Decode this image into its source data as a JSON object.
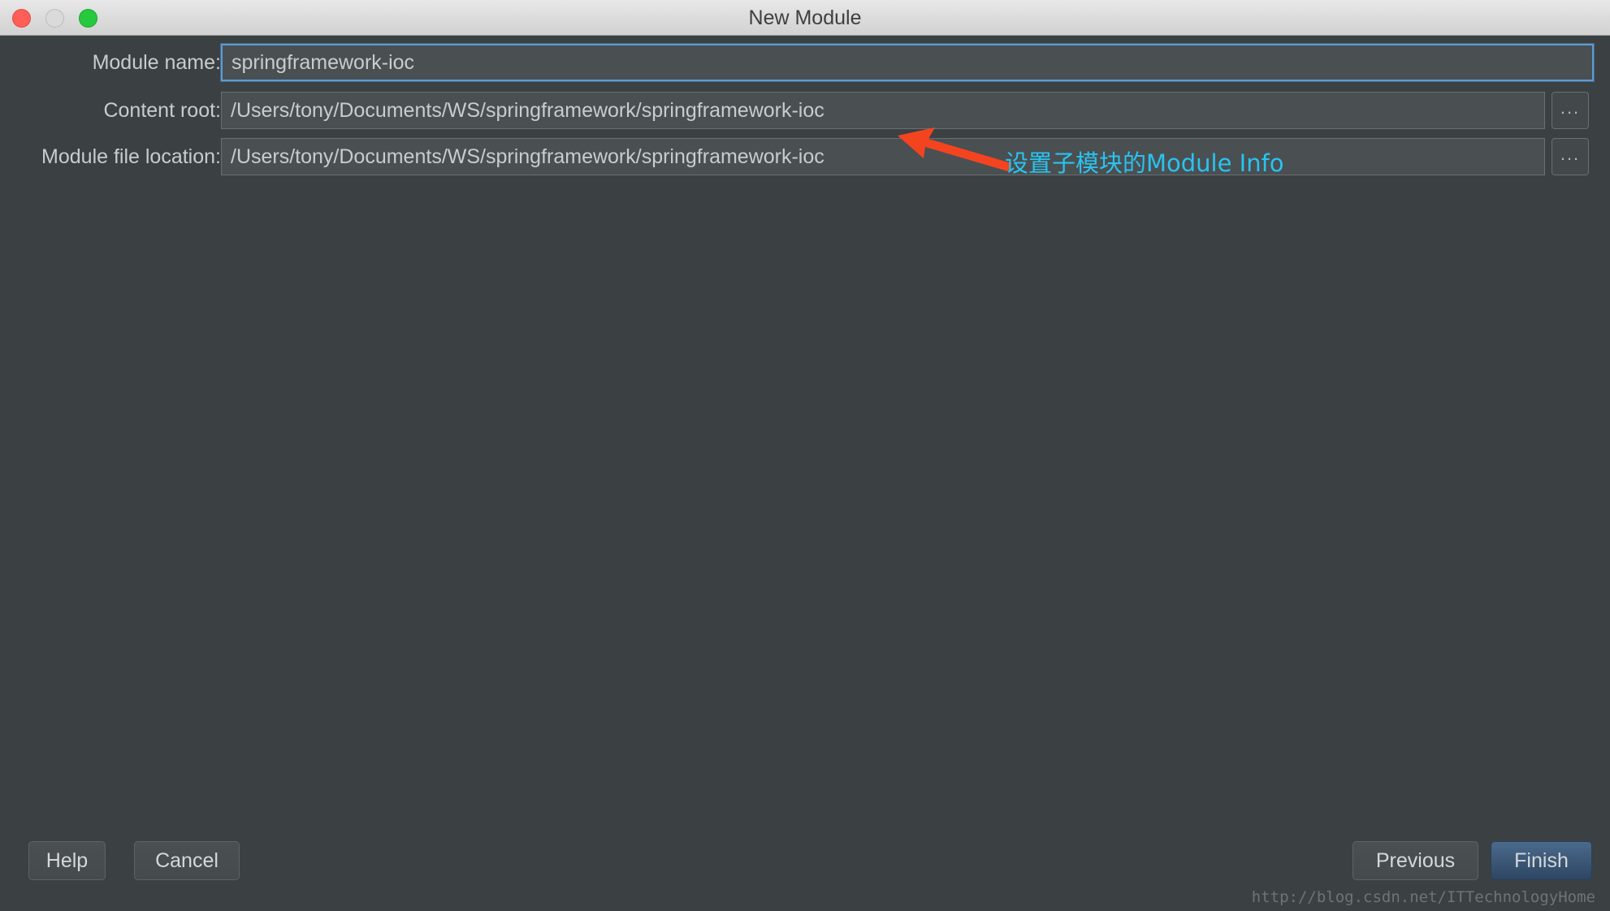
{
  "window": {
    "title": "New Module",
    "controls": {
      "close": "close-button",
      "minimize": "minimize-button",
      "maximize": "maximize-button"
    }
  },
  "form": {
    "rows": [
      {
        "label": "Module name:",
        "value": "springframework-ioc",
        "focused": true,
        "has_browse": false
      },
      {
        "label": "Content root:",
        "value": "/Users/tony/Documents/WS/springframework/springframework-ioc",
        "focused": false,
        "has_browse": true
      },
      {
        "label": "Module file location:",
        "value": "/Users/tony/Documents/WS/springframework/springframework-ioc",
        "focused": false,
        "has_browse": true
      }
    ],
    "browse_label": "..."
  },
  "annotation": {
    "text": "设置子模块的Module Info",
    "color": "#29c3ef",
    "arrow_color": "#f4441f"
  },
  "buttons": {
    "help": "Help",
    "cancel": "Cancel",
    "previous": "Previous",
    "finish": "Finish"
  },
  "watermark": "http://blog.csdn.net/ITTechnologyHome",
  "colors": {
    "dialog_bg": "#3b4043",
    "field_bg": "#4a4f52",
    "text": "#c9cccd",
    "accent_blue": "#5b9bd5",
    "finish_blue": "#3d5a7c"
  }
}
